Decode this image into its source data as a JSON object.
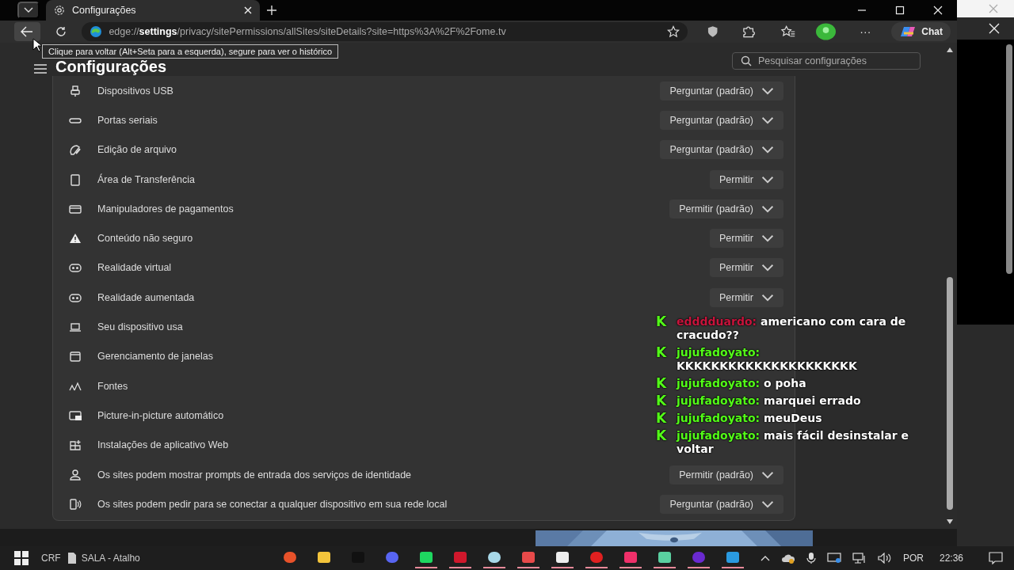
{
  "browser": {
    "tab": {
      "title": "Configurações",
      "selected": true
    },
    "address": "edge://**settings**/privacy/sitePermissions/allSites/siteDetails?site=https%3A%2F%2Fome.tv",
    "more_label": "···",
    "chat_button": "Chat",
    "tooltip": "Clique para voltar (Alt+Seta para a esquerda), segure para ver o histórico"
  },
  "settings": {
    "title": "Configurações",
    "search": {
      "placeholder": "Pesquisar configurações"
    },
    "permissions": [
      {
        "label": "Dispositivos USB",
        "value": "Perguntar (padrão)"
      },
      {
        "label": "Portas seriais",
        "value": "Perguntar (padrão)"
      },
      {
        "label": "Edição de arquivo",
        "value": "Perguntar (padrão)"
      },
      {
        "label": "Área de Transferência",
        "value": "Permitir"
      },
      {
        "label": "Manipuladores de pagamentos",
        "value": "Permitir (padrão)"
      },
      {
        "label": "Conteúdo não seguro",
        "value": "Permitir"
      },
      {
        "label": "Realidade virtual",
        "value": "Permitir"
      },
      {
        "label": "Realidade aumentada",
        "value": "Permitir"
      },
      {
        "label": "Seu dispositivo usa"
      },
      {
        "label": "Gerenciamento de janelas"
      },
      {
        "label": "Fontes"
      },
      {
        "label": "Picture-in-picture automático"
      },
      {
        "label": "Instalações de aplicativo Web"
      },
      {
        "label": "Os sites podem mostrar prompts de entrada dos serviços de identidade",
        "value": "Permitir (padrão)"
      },
      {
        "label": "Os sites podem pedir para se conectar a qualquer dispositivo em sua rede local",
        "value": "Perguntar (padrão)"
      }
    ]
  },
  "chat_overlay": {
    "messages": [
      {
        "badge": "K",
        "user": "edddduardo:",
        "color": "#c8143c",
        "text": "americano com cara de cracudo??"
      },
      {
        "badge": "K",
        "user": "jujufadoyato:",
        "color": "#53fc18",
        "text": "KKKKKKKKKKKKKKKKKKKKK"
      },
      {
        "badge": "K",
        "user": "jujufadoyato:",
        "color": "#53fc18",
        "text": "o poha"
      },
      {
        "badge": "K",
        "user": "jujufadoyato:",
        "color": "#53fc18",
        "text": "marquei errado"
      },
      {
        "badge": "K",
        "user": "jujufadoyato:",
        "color": "#53fc18",
        "text": "meuDeus"
      },
      {
        "badge": "K",
        "user": "jujufadoyato:",
        "color": "#53fc18",
        "text": "mais fácil desinstalar e voltar"
      }
    ]
  },
  "taskbar": {
    "shortcuts": [
      "CRF",
      "SALA - Atalho"
    ],
    "apps": [
      {
        "color": "#e8522a",
        "running": false
      },
      {
        "color": "#f3c43b",
        "running": false
      },
      {
        "color": "#111111",
        "running": false
      },
      {
        "color": "#5865f2",
        "running": false
      },
      {
        "color": "#1ed760",
        "running": true
      },
      {
        "color": "#d0182c",
        "running": true
      },
      {
        "color": "#a8d8e8",
        "running": true
      },
      {
        "color": "#e84a4a",
        "running": true
      },
      {
        "color": "#eeeeee",
        "running": true
      },
      {
        "color": "#e02020",
        "running": true
      },
      {
        "color": "#f0306a",
        "running": true
      },
      {
        "color": "#5ad0a0",
        "running": true
      },
      {
        "color": "#6a2ad0",
        "running": true
      },
      {
        "color": "#2a9ae0",
        "running": true
      }
    ],
    "language": "POR",
    "time": "22:36"
  }
}
